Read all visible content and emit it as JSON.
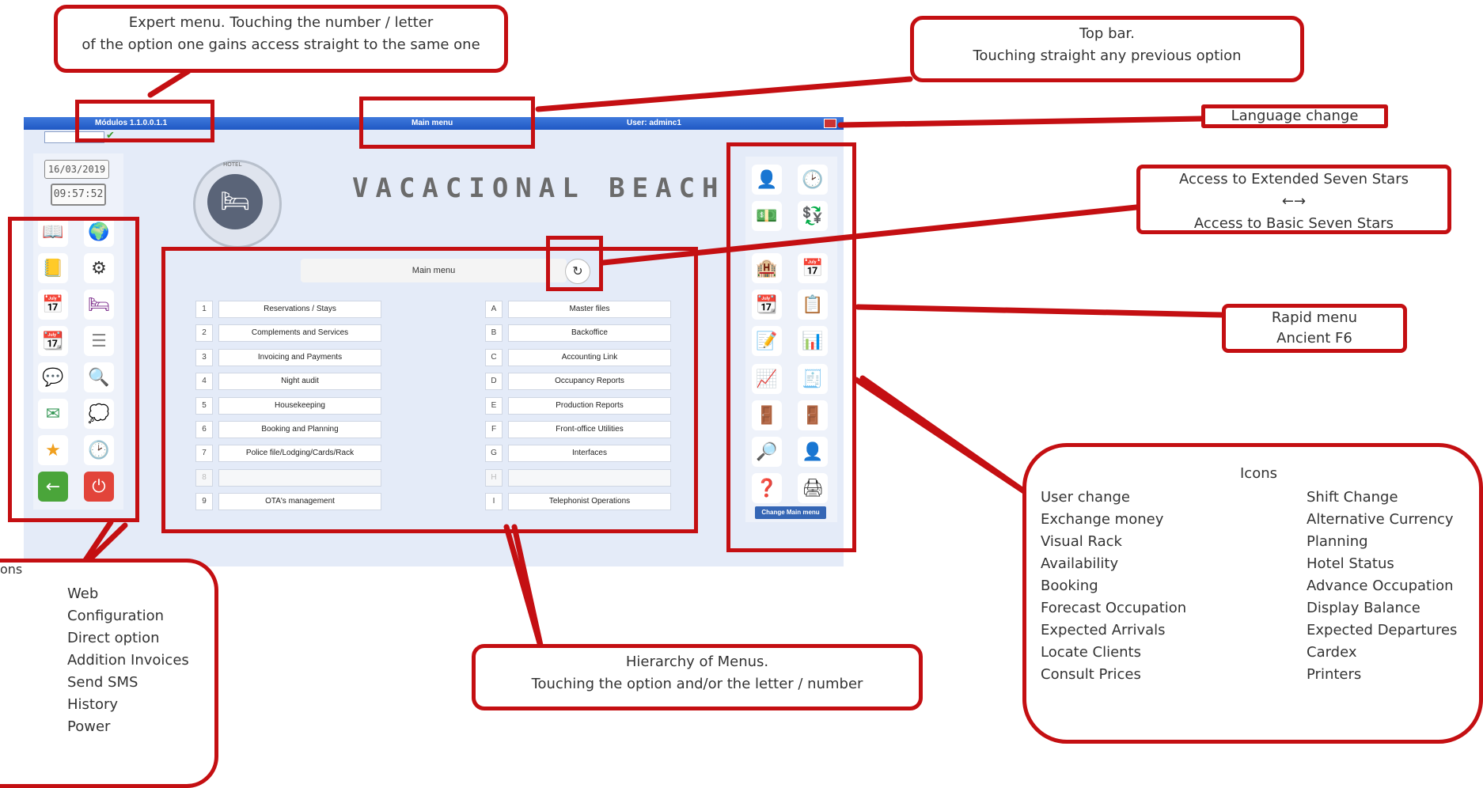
{
  "topbar": {
    "version": "Módulos 1.1.0.0.1.1",
    "title": "Main menu",
    "user": "User: adminc1"
  },
  "clock": {
    "date": "16/03/2019",
    "time": "09:57:52"
  },
  "hotel_name": "VACACIONAL BEACH CLUB",
  "logo_text": "HOTEL",
  "main_menu_header": "Main menu",
  "left_column": [
    {
      "num": "1",
      "label": "Reservations / Stays"
    },
    {
      "num": "2",
      "label": "Complements and Services"
    },
    {
      "num": "3",
      "label": "Invoicing and Payments"
    },
    {
      "num": "4",
      "label": "Night audit"
    },
    {
      "num": "5",
      "label": "Housekeeping"
    },
    {
      "num": "6",
      "label": "Booking and Planning"
    },
    {
      "num": "7",
      "label": "Police file/Lodging/Cards/Rack"
    },
    {
      "num": "8",
      "label": ""
    },
    {
      "num": "9",
      "label": "OTA's management"
    }
  ],
  "right_column": [
    {
      "num": "A",
      "label": "Master files"
    },
    {
      "num": "B",
      "label": "Backoffice"
    },
    {
      "num": "C",
      "label": "Accounting Link"
    },
    {
      "num": "D",
      "label": "Occupancy Reports"
    },
    {
      "num": "E",
      "label": "Production Reports"
    },
    {
      "num": "F",
      "label": "Front-office Utilities"
    },
    {
      "num": "G",
      "label": "Interfaces"
    },
    {
      "num": "H",
      "label": ""
    },
    {
      "num": "I",
      "label": "Telephonist Operations"
    }
  ],
  "change_main_menu": "Change Main menu",
  "left_icons": [
    "manual-icon",
    "globe-icon",
    "notes-folder-icon",
    "gears-icon",
    "calendar-direct-icon",
    "bed-icon",
    "calendar-invoice-icon",
    "list-icon",
    "chat-icon",
    "list-search-icon",
    "send-icon",
    "sms-icon",
    "star-icon",
    "clock-icon",
    "back-arrow-icon",
    "power-icon"
  ],
  "right_icons": [
    "user-change-icon",
    "shift-change-icon",
    "exchange-money-icon",
    "alternative-currency-icon",
    "visual-rack-icon",
    "planning-icon",
    "availability-icon",
    "hotel-status-icon",
    "booking-icon",
    "advance-occupation-icon",
    "forecast-occupation-icon",
    "display-balance-icon",
    "expected-arrivals-icon",
    "expected-departures-icon",
    "locate-clients-icon",
    "cardex-icon",
    "consult-prices-icon",
    "printers-icon"
  ],
  "annotations": {
    "expert": [
      "Expert menu. Touching the number / letter",
      "of the option one gains access straight to the same one"
    ],
    "topbar": [
      "Top bar.",
      "Touching straight any previous option"
    ],
    "language": "Language change",
    "access": [
      "Access to Extended Seven Stars",
      "←→",
      "Access to Basic Seven Stars"
    ],
    "rapid": [
      "Rapid menu",
      "Ancient F6"
    ],
    "icons_title": "Icons",
    "icons_col1": [
      "User change",
      "Exchange money",
      "Visual Rack",
      "Availability",
      "Booking",
      "Forecast Occupation",
      "Expected Arrivals",
      "Locate Clients",
      "Consult Prices"
    ],
    "icons_col2": [
      "Shift Change",
      "Alternative Currency",
      "Planning",
      "Hotel Status",
      "Advance Occupation",
      "Display Balance",
      "Expected Departures",
      "Cardex",
      "Printers"
    ],
    "hierarchy": [
      "Hierarchy of Menus.",
      "Touching the option and/or the letter / number"
    ],
    "options_partial": "ons",
    "options_list": [
      "Web",
      "Configuration",
      "Direct option",
      "Addition Invoices",
      "Send SMS",
      "History",
      "Power"
    ]
  },
  "colors": {
    "accent_red": "#c40f12",
    "topbar_blue": "#2a62cc",
    "app_bg": "#e4ebf8"
  }
}
